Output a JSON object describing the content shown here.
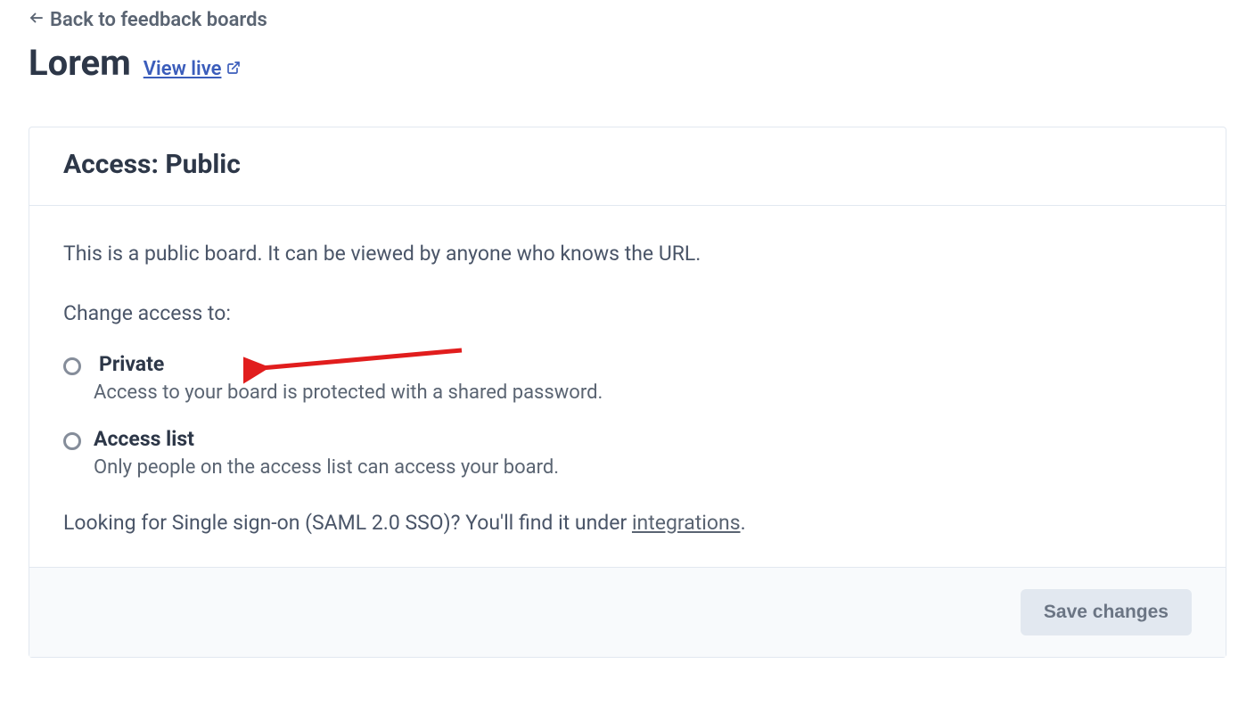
{
  "nav": {
    "back_label": "Back to feedback boards"
  },
  "header": {
    "board_title": "Lorem",
    "view_live_label": "View live"
  },
  "card": {
    "title": "Access: Public",
    "description": "This is a public board. It can be viewed by anyone who knows the URL.",
    "change_label": "Change access to:",
    "options": {
      "private": {
        "label": "Private",
        "description": "Access to your board is protected with a shared password."
      },
      "access_list": {
        "label": "Access list",
        "description": "Only people on the access list can access your board."
      }
    },
    "sso_prefix": "Looking for Single sign-on (SAML 2.0 SSO)? You'll find it under ",
    "sso_link": "integrations",
    "sso_suffix": "."
  },
  "footer": {
    "save_label": "Save changes"
  }
}
